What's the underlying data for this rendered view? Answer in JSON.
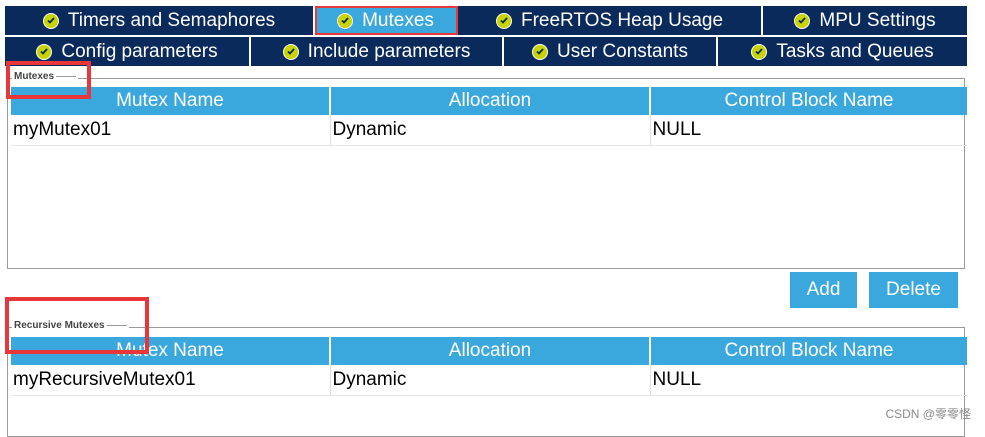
{
  "tabs": {
    "row1": [
      {
        "label": "Timers and Semaphores",
        "icon": "check-circle-icon"
      },
      {
        "label": "Mutexes",
        "icon": "check-circle-icon",
        "active": true
      },
      {
        "label": "FreeRTOS Heap Usage",
        "icon": "check-circle-icon"
      },
      {
        "label": "MPU Settings",
        "icon": "check-circle-icon"
      }
    ],
    "row2": [
      {
        "label": "Config parameters",
        "icon": "check-circle-icon"
      },
      {
        "label": "Include parameters",
        "icon": "check-circle-icon"
      },
      {
        "label": "User Constants",
        "icon": "check-circle-icon"
      },
      {
        "label": "Tasks and Queues",
        "icon": "check-circle-icon"
      }
    ]
  },
  "mutexes": {
    "title": "Mutexes",
    "columns": [
      "Mutex Name",
      "Allocation",
      "Control Block Name"
    ],
    "rows": [
      [
        "myMutex01",
        "Dynamic",
        "NULL"
      ]
    ],
    "add_label": "Add",
    "delete_label": "Delete"
  },
  "recursive_mutexes": {
    "title": "Recursive Mutexes",
    "columns": [
      "Mutex Name",
      "Allocation",
      "Control Block Name"
    ],
    "rows": [
      [
        "myRecursiveMutex01",
        "Dynamic",
        "NULL"
      ]
    ]
  },
  "watermark": "CSDN @零零怪",
  "colors": {
    "tab_bg": "#0a2a5c",
    "accent": "#3aa8dc",
    "highlight": "#e8373b",
    "check": "#c8d400"
  }
}
